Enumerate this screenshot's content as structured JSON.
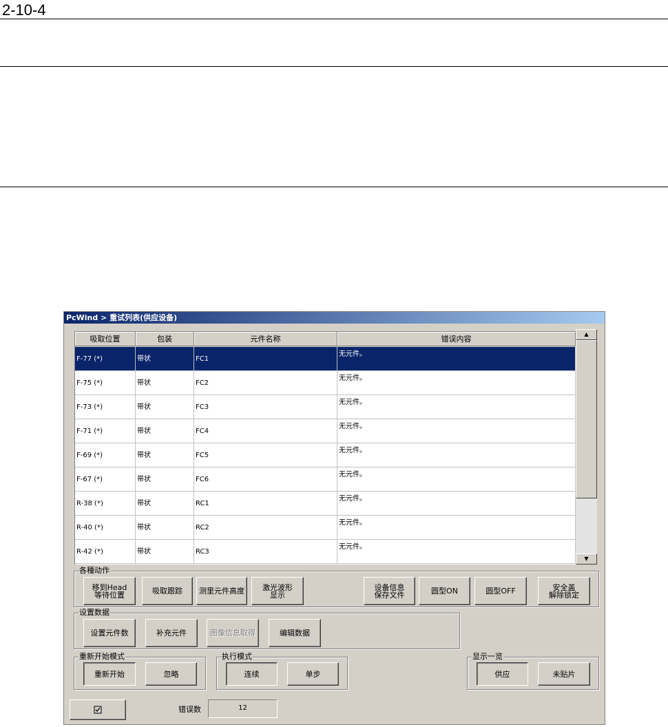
{
  "document": {
    "page_number": "2-10-4"
  },
  "window": {
    "title": "PcWind > 重试列表(供应设备)"
  },
  "table": {
    "columns": [
      "吸取位置",
      "包装",
      "元件名称",
      "错误内容"
    ],
    "rows": [
      {
        "position": "F-77 (*)",
        "package": "带状",
        "part": "FC1",
        "error": "无元件。",
        "selected": true
      },
      {
        "position": "F-75 (*)",
        "package": "带状",
        "part": "FC2",
        "error": "无元件。"
      },
      {
        "position": "F-73 (*)",
        "package": "带状",
        "part": "FC3",
        "error": "无元件。"
      },
      {
        "position": "F-71 (*)",
        "package": "带状",
        "part": "FC4",
        "error": "无元件。"
      },
      {
        "position": "F-69 (*)",
        "package": "带状",
        "part": "FC5",
        "error": "无元件。"
      },
      {
        "position": "F-67 (*)",
        "package": "带状",
        "part": "FC6",
        "error": "无元件。"
      },
      {
        "position": "R-38 (*)",
        "package": "带状",
        "part": "RC1",
        "error": "无元件。"
      },
      {
        "position": "R-40 (*)",
        "package": "带状",
        "part": "RC2",
        "error": "无元件。"
      },
      {
        "position": "R-42 (*)",
        "package": "带状",
        "part": "RC3",
        "error": "无元件。"
      }
    ]
  },
  "actions": {
    "label": "各種动作",
    "move_head": "移到Head\n等待位置",
    "pickup_trace": "吸取跟踪",
    "measure_height": "测里元件高度",
    "laser_wave": "激光波形\n显示",
    "save_device_info": "设备信息\n保存文件",
    "round_on": "圆型ON",
    "round_off": "圆型OFF",
    "safety_unlock": "安全盖\n解除锁定"
  },
  "settings": {
    "label": "设置数据",
    "set_count": "设置元件数",
    "replenish": "补充元件",
    "image_info": "图像信息取得",
    "edit_data": "编辑数据"
  },
  "restart_mode": {
    "label": "重新开始模式",
    "restart": "重新开始",
    "ignore": "忽略"
  },
  "exec_mode": {
    "label": "执行模式",
    "continuous": "连续",
    "step": "单步"
  },
  "display": {
    "label": "显示一览",
    "supply": "供应",
    "unplaced": "未贴片"
  },
  "footer": {
    "check_icon": "checkbox-icon",
    "error_count_label": "错误数",
    "error_count": "12"
  },
  "colors": {
    "selection": "#0a246a",
    "window_bg": "#d4d0c8"
  }
}
